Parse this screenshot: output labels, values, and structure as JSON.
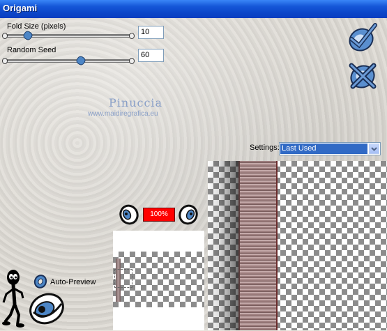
{
  "window": {
    "title": "Origami"
  },
  "controls": {
    "fold_size": {
      "label": "Fold Size (pixels)",
      "value": "10"
    },
    "random_seed": {
      "label": "Random Seed",
      "value": "60"
    }
  },
  "watermark": {
    "name": "Pinuccia",
    "url": "www.maidiregrafica.eu"
  },
  "settings": {
    "label": "Settings:",
    "selected": "Last Used"
  },
  "zoom": {
    "value": "100%"
  },
  "preview": {
    "auto_preview_label": "Auto-Preview"
  },
  "buttons": {
    "ok": "checkmark-icon",
    "cancel": "x-icon"
  },
  "colors": {
    "titlebar": "#0b46c9",
    "accent": "#4d86c6",
    "zoom_box": "#ff0000",
    "selection": "#316ac5"
  }
}
